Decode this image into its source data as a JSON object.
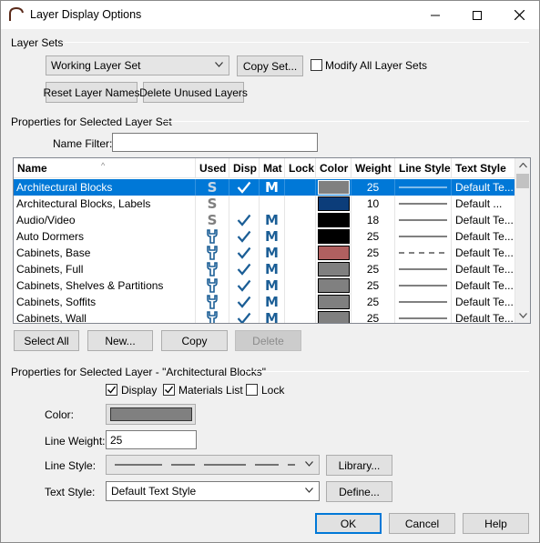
{
  "window": {
    "title": "Layer Display Options"
  },
  "layer_sets": {
    "group_label": "Layer Sets",
    "selected_set": "Working Layer Set",
    "copy_set_label": "Copy Set...",
    "modify_all_label": "Modify All Layer Sets",
    "modify_all_checked": false,
    "reset_label": "Reset Layer Names",
    "delete_unused_label": "Delete Unused Layers"
  },
  "properties_set": {
    "group_label": "Properties for Selected Layer Set",
    "name_filter_label": "Name Filter:",
    "name_filter_value": ""
  },
  "table": {
    "columns": [
      "Name",
      "Used",
      "Disp",
      "Mat",
      "Lock",
      "Color",
      "Weight",
      "Line Style",
      "Text Style"
    ],
    "rows": [
      {
        "name": "Architectural Blocks",
        "used": "S",
        "disp": true,
        "mat": "M",
        "color": "#808080",
        "weight": "25",
        "line_style": "solid",
        "text_style": "Default Te...",
        "selected": true
      },
      {
        "name": "Architectural Blocks, Labels",
        "used": "S",
        "disp": false,
        "mat": "",
        "color": "#0c3d7a",
        "weight": "10",
        "line_style": "solid",
        "text_style": "Default ...",
        "selected": false
      },
      {
        "name": "Audio/Video",
        "used": "S",
        "disp": true,
        "mat": "M",
        "color": "#000000",
        "weight": "18",
        "line_style": "solid",
        "text_style": "Default Te...",
        "selected": false
      },
      {
        "name": "Auto Dormers",
        "used": "wrench",
        "disp": true,
        "mat": "M",
        "color": "#000000",
        "weight": "25",
        "line_style": "solid",
        "text_style": "Default Te...",
        "selected": false
      },
      {
        "name": "Cabinets,  Base",
        "used": "wrench",
        "disp": true,
        "mat": "M",
        "color": "#b06060",
        "weight": "25",
        "line_style": "dashed",
        "text_style": "Default Te...",
        "selected": false
      },
      {
        "name": "Cabinets,  Full",
        "used": "wrench",
        "disp": true,
        "mat": "M",
        "color": "#808080",
        "weight": "25",
        "line_style": "solid",
        "text_style": "Default Te...",
        "selected": false
      },
      {
        "name": "Cabinets,  Shelves & Partitions",
        "used": "wrench",
        "disp": true,
        "mat": "M",
        "color": "#808080",
        "weight": "25",
        "line_style": "solid",
        "text_style": "Default Te...",
        "selected": false
      },
      {
        "name": "Cabinets,  Soffits",
        "used": "wrench",
        "disp": true,
        "mat": "M",
        "color": "#808080",
        "weight": "25",
        "line_style": "solid",
        "text_style": "Default Te...",
        "selected": false
      },
      {
        "name": "Cabinets,  Wall",
        "used": "wrench",
        "disp": true,
        "mat": "M",
        "color": "#808080",
        "weight": "25",
        "line_style": "solid",
        "text_style": "Default Te...",
        "selected": false
      }
    ]
  },
  "table_buttons": {
    "select_all": "Select All",
    "new": "New...",
    "copy": "Copy",
    "delete": "Delete"
  },
  "properties_layer": {
    "group_label": "Properties for Selected Layer - \"Architectural Blocks\"",
    "display_label": "Display",
    "display_checked": true,
    "materials_label": "Materials List",
    "materials_checked": true,
    "lock_label": "Lock",
    "lock_checked": false,
    "color_label": "Color:",
    "color_value": "#808080",
    "line_weight_label": "Line Weight:",
    "line_weight_value": "25",
    "line_style_label": "Line Style:",
    "library_label": "Library...",
    "text_style_label": "Text Style:",
    "text_style_value": "Default Text Style",
    "define_label": "Define..."
  },
  "footer": {
    "ok": "OK",
    "cancel": "Cancel",
    "help": "Help"
  }
}
